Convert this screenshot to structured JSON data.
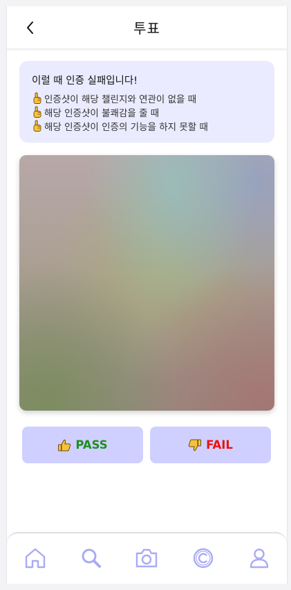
{
  "header": {
    "title": "투표",
    "back_icon": "chevron-left-icon"
  },
  "notice": {
    "title": "이럴 때 인증 실패입니다!",
    "items": [
      "인증샷이 해당 챌린지와 연관이 없을 때",
      "해당 인증샷이 불쾌감을 줄 때",
      "해당 인증샷이 인증의 기능을 하지 못할 때"
    ],
    "item_icon": "pointing-up-hand-icon"
  },
  "vote": {
    "pass_label": "PASS",
    "fail_label": "FAIL",
    "pass_color": "#1f8f1f",
    "fail_color": "#ee1111",
    "button_bg": "#cfd0ff"
  },
  "bottom_nav": {
    "items": [
      "home-icon",
      "search-icon",
      "camera-icon",
      "copyright-icon",
      "user-icon"
    ],
    "icon_color": "#a9aaf5"
  },
  "colors": {
    "notice_bg": "#ebebff"
  }
}
